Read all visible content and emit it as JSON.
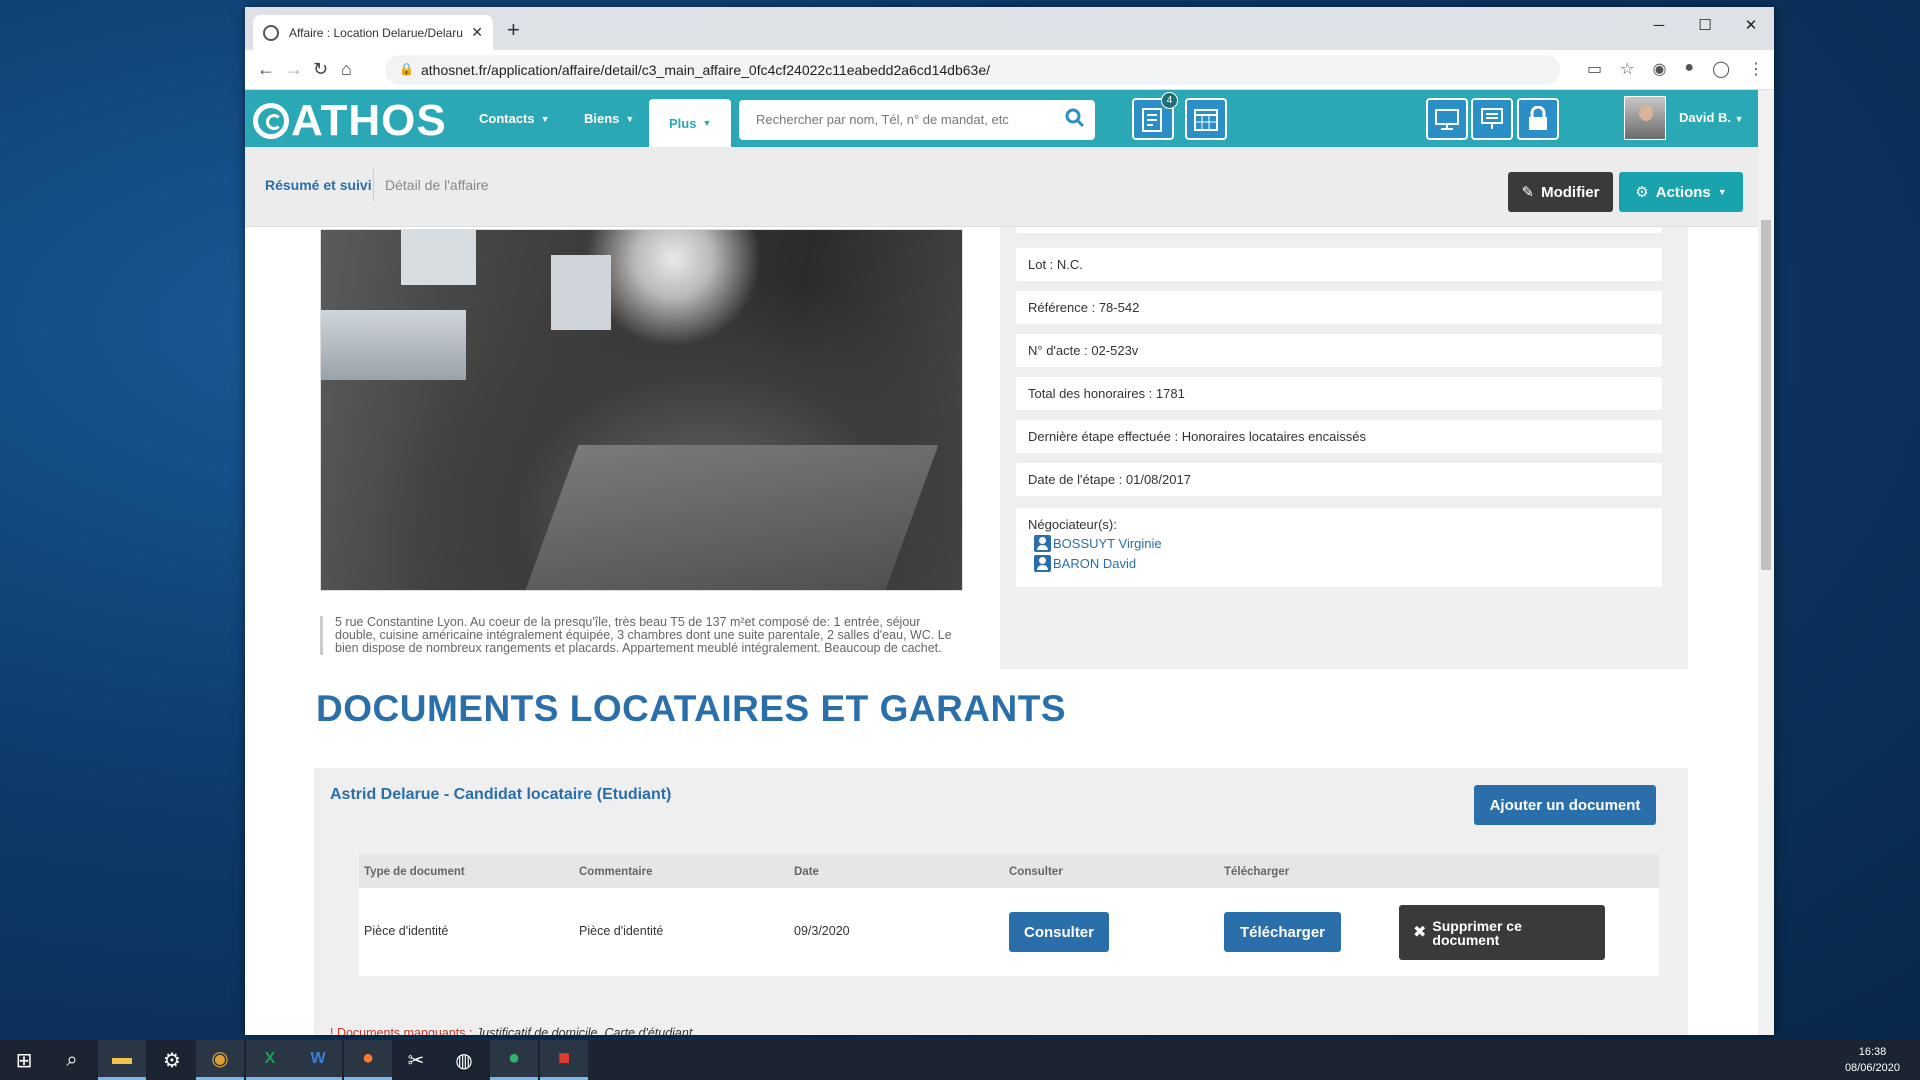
{
  "browser": {
    "tab_title": "Affaire : Location Delarue/Delaru",
    "new_tab": "+",
    "url": "athosnet.fr/application/affaire/detail/c3_main_affaire_0fc4cf24022c11eabedd2a6cd14db63e/"
  },
  "app": {
    "logo": "ATHOS",
    "menu": [
      "Contacts",
      "Biens",
      "Plus"
    ],
    "search_placeholder": "Rechercher par nom, Tél, n° de mandat, etc",
    "notif_count": "4",
    "user": "David B."
  },
  "subheader": {
    "tab_summary": "Résumé et suivi",
    "tab_detail": "Détail de l'affaire",
    "btn_modify": "Modifier",
    "btn_actions": "Actions"
  },
  "property": {
    "description": "5 rue Constantine Lyon. Au coeur de la presqu'île, très beau T5 de 137 m²et composé de: 1 entrée, séjour double, cuisine américaine intégralement équipée, 3 chambres dont une suite parentale, 2 salles d'eau, WC. Le bien dispose de nombreux rangements et placards. Appartement meublé intégralement. Beaucoup de cachet.",
    "lot": "Lot : N.C.",
    "reference": "Référence : 78-542",
    "acte": "N° d'acte : 02-523v",
    "honoraires": "Total des honoraires : 1781",
    "etape": "Dernière étape effectuée : Honoraires locataires encaissés",
    "date_etape": "Date de l'étape : 01/08/2017",
    "negociateurs_label": "Négociateur(s):",
    "negociateurs": [
      "BOSSUYT Virginie",
      "BARON David"
    ]
  },
  "documents": {
    "title": "DOCUMENTS LOCATAIRES ET GARANTS",
    "candidate": "Astrid Delarue - Candidat locataire (Etudiant)",
    "add_button": "Ajouter un document",
    "columns": [
      "Type de document",
      "Commentaire",
      "Date",
      "Consulter",
      "Télécharger"
    ],
    "rows": [
      {
        "type": "Pièce d'identité",
        "comment": "Pièce d'identité",
        "date": "09/3/2020",
        "consult": "Consulter",
        "download": "Télécharger",
        "delete": "Supprimer ce document"
      }
    ],
    "missing_label": "! Documents manquants :",
    "missing_list": "Justificatif de domicile, Carte d'étudiant"
  },
  "taskbar": {
    "time": "16:38",
    "date": "08/06/2020"
  }
}
